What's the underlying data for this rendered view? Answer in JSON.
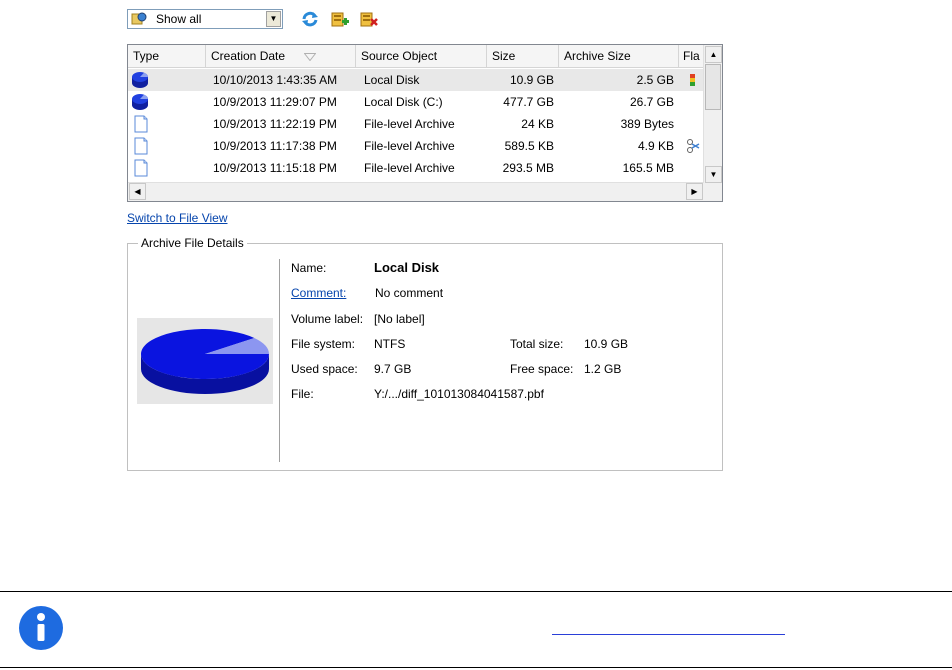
{
  "toolbar": {
    "filter_value": "Show all",
    "buttons": [
      {
        "name": "refresh-icon",
        "color": "#2a8ad8"
      },
      {
        "name": "add-archive-icon",
        "color": "#e0a020"
      },
      {
        "name": "delete-archive-icon",
        "color": "#d02020"
      }
    ]
  },
  "table": {
    "columns": [
      "Type",
      "Creation Date",
      "Source Object",
      "Size",
      "Archive Size",
      "Fla"
    ],
    "rows": [
      {
        "type": "disk-icon",
        "date": "10/10/2013 1:43:35 AM",
        "source": "Local Disk",
        "size": "10.9 GB",
        "archive_size": "2.5 GB",
        "flag": "multicolor-flag-icon"
      },
      {
        "type": "disk-icon",
        "date": "10/9/2013 11:29:07 PM",
        "source": "Local Disk (C:)",
        "size": "477.7 GB",
        "archive_size": "26.7 GB",
        "flag": ""
      },
      {
        "type": "file-icon",
        "date": "10/9/2013 11:22:19 PM",
        "source": "File-level Archive",
        "size": "24 KB",
        "archive_size": "389 Bytes",
        "flag": ""
      },
      {
        "type": "file-icon",
        "date": "10/9/2013 11:17:38 PM",
        "source": "File-level Archive",
        "size": "589.5 KB",
        "archive_size": "4.9 KB",
        "flag": "chain-link-icon"
      },
      {
        "type": "file-icon",
        "date": "10/9/2013 11:15:18 PM",
        "source": "File-level Archive",
        "size": "293.5 MB",
        "archive_size": "165.5 MB",
        "flag": ""
      }
    ]
  },
  "switch_view_link": "Switch to File View",
  "details": {
    "legend": "Archive File Details",
    "name_label": "Name:",
    "name_value": "Local Disk",
    "comment_label": "Comment:",
    "comment_value": "No comment",
    "volume_label_label": "Volume label:",
    "volume_label_value": "[No label]",
    "file_system_label": "File system:",
    "file_system_value": "NTFS",
    "total_size_label": "Total size:",
    "total_size_value": "10.9 GB",
    "used_space_label": "Used space:",
    "used_space_value": "9.7 GB",
    "free_space_label": "Free space:",
    "free_space_value": "1.2 GB",
    "file_label": "File:",
    "file_value": "Y:/.../diff_101013084041587.pbf",
    "used_fraction": 0.89,
    "pie_color": "#0a14e0",
    "pie_free_color": "#8c96f0"
  },
  "info_icon_color": "#1e6be0"
}
